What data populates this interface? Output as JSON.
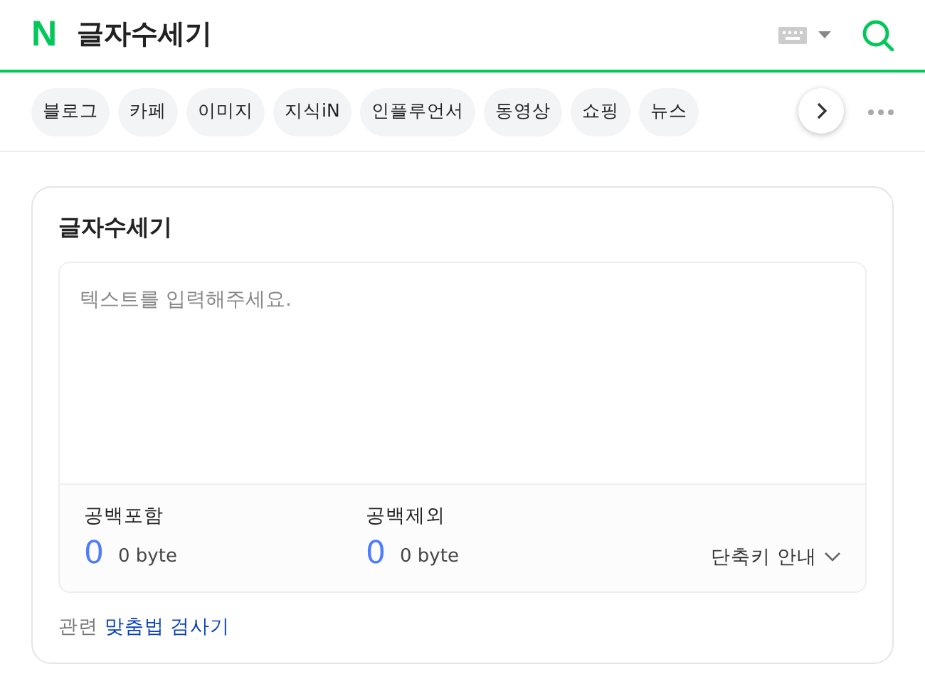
{
  "header": {
    "logo": "N",
    "title": "글자수세기"
  },
  "tabs": [
    "블로그",
    "카페",
    "이미지",
    "지식iN",
    "인플루언서",
    "동영상",
    "쇼핑",
    "뉴스"
  ],
  "card": {
    "title": "글자수세기",
    "placeholder": "텍스트를 입력해주세요.",
    "stats": [
      {
        "label": "공백포함",
        "count": "0",
        "bytes": "0 byte"
      },
      {
        "label": "공백제외",
        "count": "0",
        "bytes": "0 byte"
      }
    ],
    "shortcut": "단축키 안내",
    "related_label": "관련",
    "related_link": "맞춤법 검사기"
  }
}
